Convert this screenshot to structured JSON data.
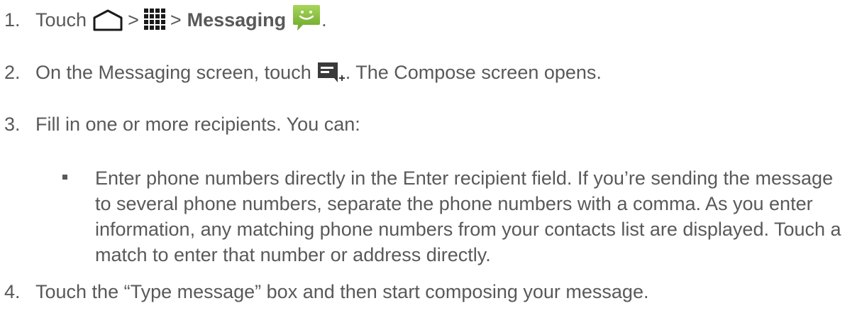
{
  "steps": [
    {
      "number": "1.",
      "parts": {
        "touch": "Touch",
        "sep1": ">",
        "sep2": ">",
        "app_name": "Messaging",
        "end": "."
      },
      "icons": [
        "home-icon",
        "apps-icon",
        "messaging-app-icon"
      ]
    },
    {
      "number": "2.",
      "before_icon": "On the Messaging screen, touch",
      "after_icon": ". The Compose screen opens.",
      "icon": "compose-icon"
    },
    {
      "number": "3.",
      "text": "Fill in one or more recipients. You can:"
    },
    {
      "number": "4.",
      "text": "Touch the “Type message” box and then start composing your message."
    }
  ],
  "sub_items": [
    {
      "text": "Enter phone numbers directly in the Enter recipient field. If you’re sending the message to several phone numbers, separate the phone numbers with a comma. As you enter information, any matching phone numbers from your contacts list are displayed. Touch a match to enter that number or address directly."
    }
  ],
  "colors": {
    "text": "#595959",
    "messaging_icon_green": "#8dc63f",
    "icon_dark": "#1a1a1a"
  }
}
